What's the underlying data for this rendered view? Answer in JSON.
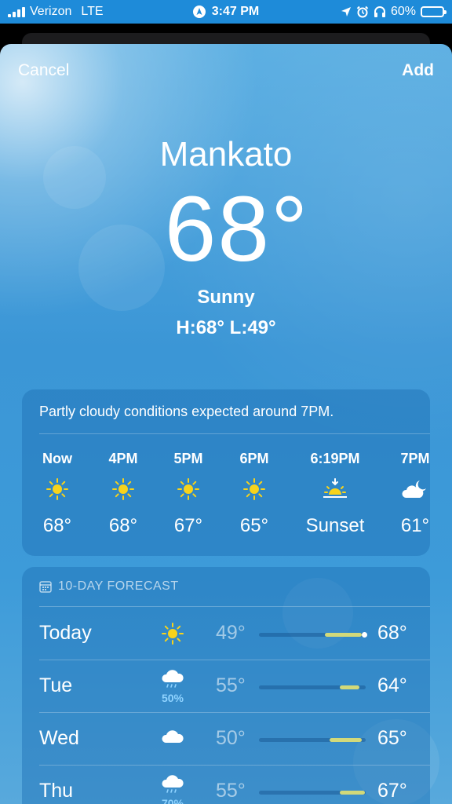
{
  "status": {
    "carrier": "Verizon",
    "network": "LTE",
    "time": "3:47 PM",
    "battery": "60%",
    "battery_level": 0.6
  },
  "nav": {
    "cancel_label": "Cancel",
    "add_label": "Add"
  },
  "current": {
    "city": "Mankato",
    "temp": "68°",
    "condition": "Sunny",
    "hi_lo": "H:68°  L:49°"
  },
  "hourly": {
    "summary": "Partly cloudy conditions expected around 7PM.",
    "items": [
      {
        "time": "Now",
        "icon": "sun-icon",
        "value": "68°"
      },
      {
        "time": "4PM",
        "icon": "sun-icon",
        "value": "68°"
      },
      {
        "time": "5PM",
        "icon": "sun-icon",
        "value": "67°"
      },
      {
        "time": "6PM",
        "icon": "sun-icon",
        "value": "65°"
      },
      {
        "time": "6:19PM",
        "icon": "sunset-icon",
        "value": "Sunset"
      },
      {
        "time": "7PM",
        "icon": "partly-cloudy-night-icon",
        "value": "61°"
      }
    ]
  },
  "daily": {
    "header": "10-DAY FORECAST",
    "days": [
      {
        "name": "Today",
        "icon": "sun-icon",
        "precip": "",
        "low": "49°",
        "high": "68°",
        "range_start": 0.62,
        "range_end": 0.96,
        "current_marker": 0.99
      },
      {
        "name": "Tue",
        "icon": "rain-icon",
        "precip": "50%",
        "low": "55°",
        "high": "64°",
        "range_start": 0.76,
        "range_end": 0.94
      },
      {
        "name": "Wed",
        "icon": "cloud-icon",
        "precip": "",
        "low": "50°",
        "high": "65°",
        "range_start": 0.66,
        "range_end": 0.96
      },
      {
        "name": "Thu",
        "icon": "rain-icon",
        "precip": "70%",
        "low": "55°",
        "high": "67°",
        "range_start": 0.76,
        "range_end": 0.99
      }
    ]
  },
  "colors": {
    "sun": "#f7d31b",
    "bar": "#d2d97a",
    "precip": "#8fd3ff",
    "sky": "#3b96d6"
  }
}
